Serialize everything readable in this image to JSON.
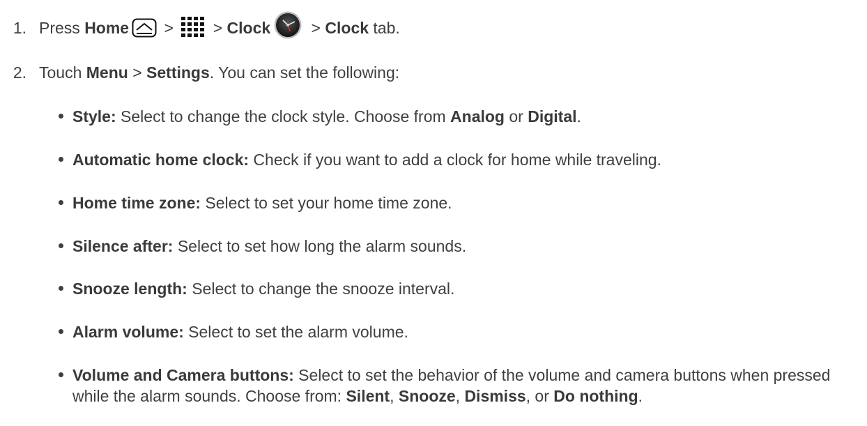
{
  "steps": [
    {
      "number": "1.",
      "press": "Press ",
      "home": "Home",
      "sep1": " > ",
      "sep2": " > ",
      "clock": "Clock",
      "sep3": " > ",
      "clock_tab": "Clock",
      "tab_suffix": " tab."
    },
    {
      "number": "2.",
      "touch": "Touch ",
      "menu": "Menu",
      "sep": " > ",
      "settings": "Settings",
      "rest": ". You can set the following:"
    }
  ],
  "icons": {
    "home": "home-icon",
    "apps": "apps-grid-icon",
    "clock": "clock-icon"
  },
  "options": [
    {
      "label": "Style:",
      "text": " Select to change the clock style. Choose from ",
      "b1": "Analog",
      "mid": " or ",
      "b2": "Digital",
      "end": "."
    },
    {
      "label": "Automatic home clock:",
      "text": " Check if you want to add a clock for home while traveling."
    },
    {
      "label": "Home time zone:",
      "text": " Select to set your home time zone."
    },
    {
      "label": "Silence after:",
      "text": " Select to set how long the alarm sounds."
    },
    {
      "label": "Snooze length:",
      "text": " Select to change the snooze interval."
    },
    {
      "label": "Alarm volume:",
      "text": " Select to set the alarm volume."
    },
    {
      "label": "Volume and Camera buttons:",
      "text": " Select to set the behavior of the volume and camera buttons when pressed while the alarm sounds. Choose from: ",
      "b1": "Silent",
      "c1": ", ",
      "b2": "Snooze",
      "c2": ", ",
      "b3": "Dismiss",
      "c3": ", or ",
      "b4": "Do nothing",
      "end": "."
    }
  ]
}
